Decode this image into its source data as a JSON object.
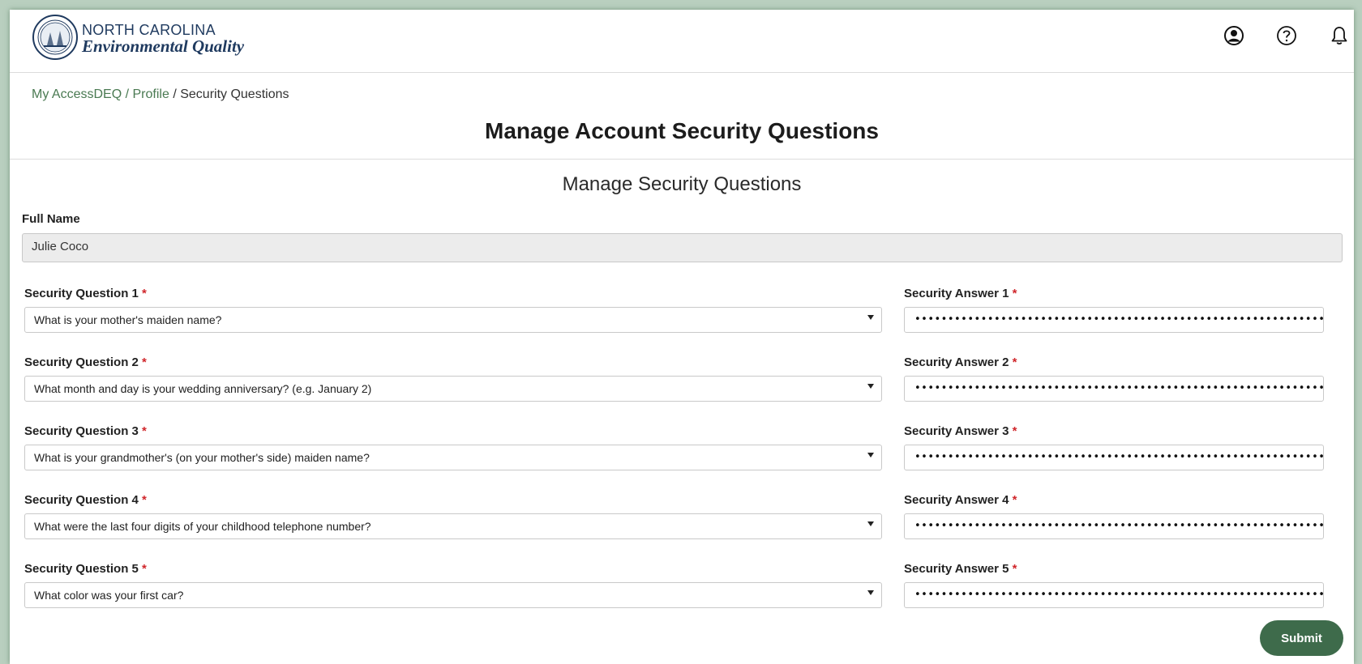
{
  "brand": {
    "line1": "NORTH CAROLINA",
    "line2": "Environmental Quality",
    "color": "#1f3a5f"
  },
  "header_icons": [
    "user-circle-icon",
    "help-circle-icon",
    "bell-icon"
  ],
  "breadcrumb": {
    "items": [
      "My AccessDEQ",
      "Profile",
      "Security Questions"
    ],
    "separator": "/"
  },
  "page_title": "Manage Account Security Questions",
  "section_title": "Manage Security Questions",
  "full_name": {
    "label": "Full Name",
    "value": "Julie Coco"
  },
  "required_marker": "*",
  "questions": [
    {
      "label": "Security Question 1",
      "value": "What is your mother's maiden name?",
      "answer_label": "Security Answer 1",
      "answer_mask": "••••••••••••••••••••••••••••••••••••••••••••••••••••••••••••••••••••••"
    },
    {
      "label": "Security Question 2",
      "value": "What month and day is your wedding anniversary? (e.g. January 2)",
      "answer_label": "Security Answer 2",
      "answer_mask": "••••••••••••••••••••••••••••••••••••••••••••••••••••••••••••••••••••••"
    },
    {
      "label": "Security Question 3",
      "value": "What is your grandmother's (on your mother's side) maiden name?",
      "answer_label": "Security Answer 3",
      "answer_mask": "••••••••••••••••••••••••••••••••••••••••••••••••••••••••••••••••••••••"
    },
    {
      "label": "Security Question 4",
      "value": "What were the last four digits of your childhood telephone number?",
      "answer_label": "Security Answer 4",
      "answer_mask": "••••••••••••••••••••••••••••••••••••••••••••••••••••••••••••••••••••••"
    },
    {
      "label": "Security Question 5",
      "value": "What color was your first car?",
      "answer_label": "Security Answer 5",
      "answer_mask": "••••••••••••••••••••••••••••••••••••••••••••••••••••••••••••••••••••••"
    }
  ],
  "submit_label": "Submit",
  "colors": {
    "accent": "#3e6b4b",
    "link": "#4a7a52",
    "required": "#d0262b"
  }
}
